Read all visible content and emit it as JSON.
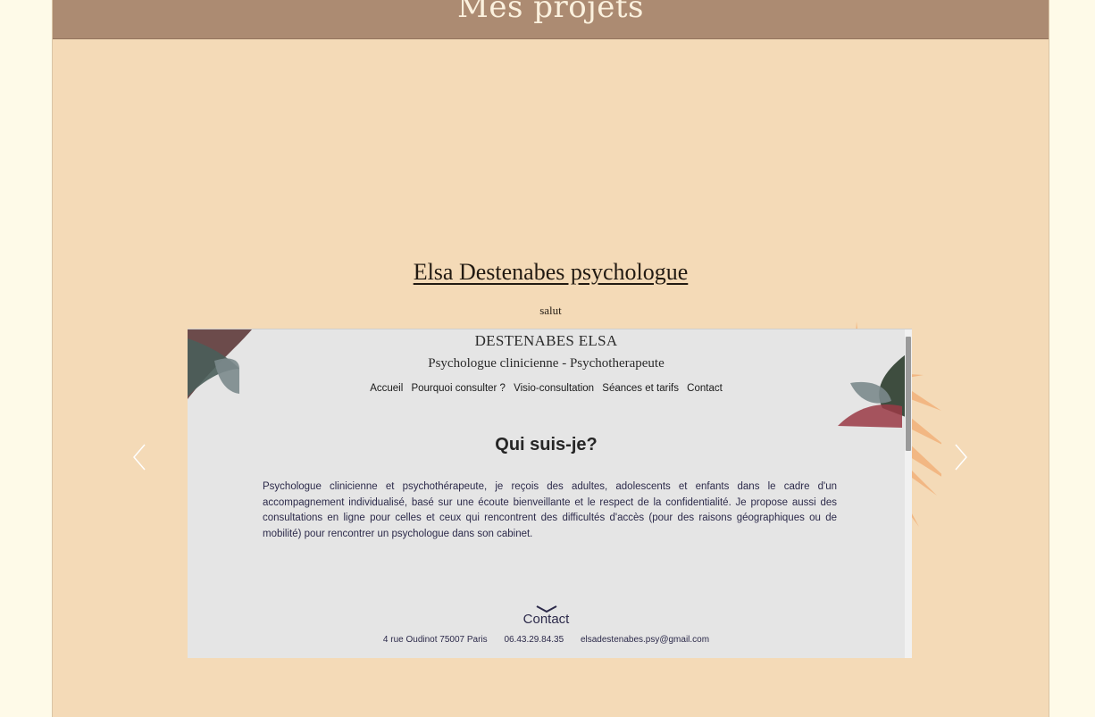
{
  "header": {
    "title": "Mes projets"
  },
  "project": {
    "title": "Elsa Destenabes psychologue",
    "subtitle": "salut"
  },
  "carousel": {
    "prev_icon": "chevron-left-icon",
    "next_icon": "chevron-right-icon"
  },
  "screenshot": {
    "name": "DESTENABES ELSA",
    "role": "Psychologue clinicienne - Psychotherapeute",
    "nav": [
      "Accueil",
      "Pourquoi consulter ?",
      "Visio-consultation",
      "Séances et tarifs",
      "Contact"
    ],
    "heading": "Qui suis-je?",
    "paragraph": "Psychologue clinicienne et psychothérapeute, je reçois des adultes, adolescents et enfants dans le cadre d'un accompagnement individualisé, basé sur une écoute bienveillante et le respect de la confidentialité. Je propose aussi des consultations en ligne pour celles et ceux qui rencontrent des difficultés d'accès (pour des raisons géographiques ou de mobilité) pour rencontrer un psychologue dans son cabinet.",
    "contact_label": "Contact",
    "address": "4 rue Oudinot 75007 Paris",
    "phone": "06.43.29.84.35",
    "email": "elsadestenabes.psy@gmail.com"
  },
  "colors": {
    "page_bg": "#fefae8",
    "panel_bg": "#f4dab7",
    "header_bg": "#ac8b72",
    "accent_orange": "#f2b27a"
  }
}
